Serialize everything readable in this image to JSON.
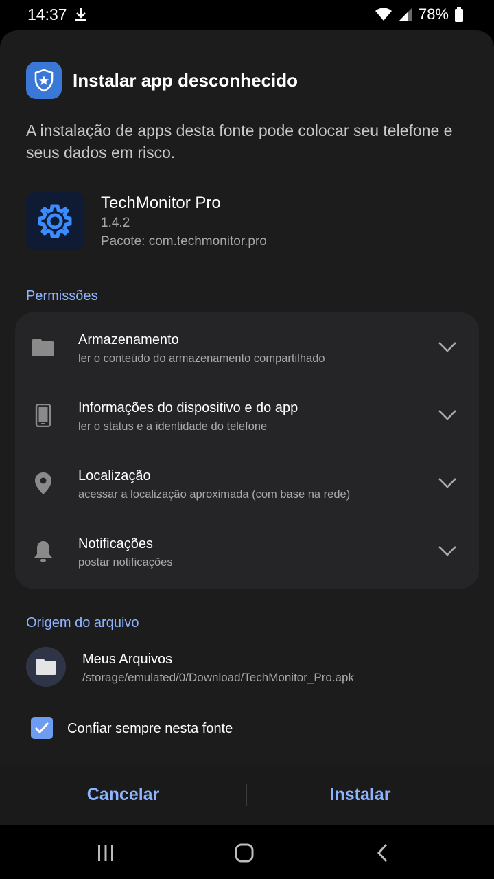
{
  "status_bar": {
    "time": "14:37",
    "battery_percent": "78%",
    "icons": [
      "download-icon",
      "wifi-icon",
      "signal-icon",
      "battery-icon"
    ]
  },
  "dialog": {
    "title": "Instalar app desconhecido",
    "title_icon": "shield-icon",
    "warning": "A instalação de apps desta fonte pode colocar seu telefone e seus dados em risco."
  },
  "app": {
    "icon": "gear-icon",
    "name": "TechMonitor Pro",
    "version": "1.4.2",
    "package": "Pacote: com.techmonitor.pro"
  },
  "permissions": {
    "section_label": "Permissões",
    "items": [
      {
        "icon": "folder-icon",
        "title": "Armazenamento",
        "desc": "ler o conteúdo do armazenamento compartilhado"
      },
      {
        "icon": "phone-icon",
        "title": "Informações do dispositivo e do app",
        "desc": "ler o status e a identidade do telefone"
      },
      {
        "icon": "location-pin-icon",
        "title": "Localização",
        "desc": "acessar a localização aproximada (com base na rede)"
      },
      {
        "icon": "bell-icon",
        "title": "Notificações",
        "desc": "postar notificações"
      }
    ]
  },
  "source": {
    "section_label": "Origem do arquivo",
    "icon": "folder-icon",
    "name": "Meus Arquivos",
    "path": "/storage/emulated/0/Download/TechMonitor_Pro.apk"
  },
  "trust_checkbox": {
    "label": "Confiar sempre nesta fonte",
    "checked": true
  },
  "actions": {
    "cancel": "Cancelar",
    "install": "Instalar"
  },
  "nav": {
    "icons": [
      "recents-icon",
      "home-icon",
      "back-icon"
    ]
  },
  "colors": {
    "accent": "#8fb4ff",
    "sheet_bg": "#1c1c1d",
    "card_bg": "#252527",
    "checkbox": "#6e9cf0"
  }
}
